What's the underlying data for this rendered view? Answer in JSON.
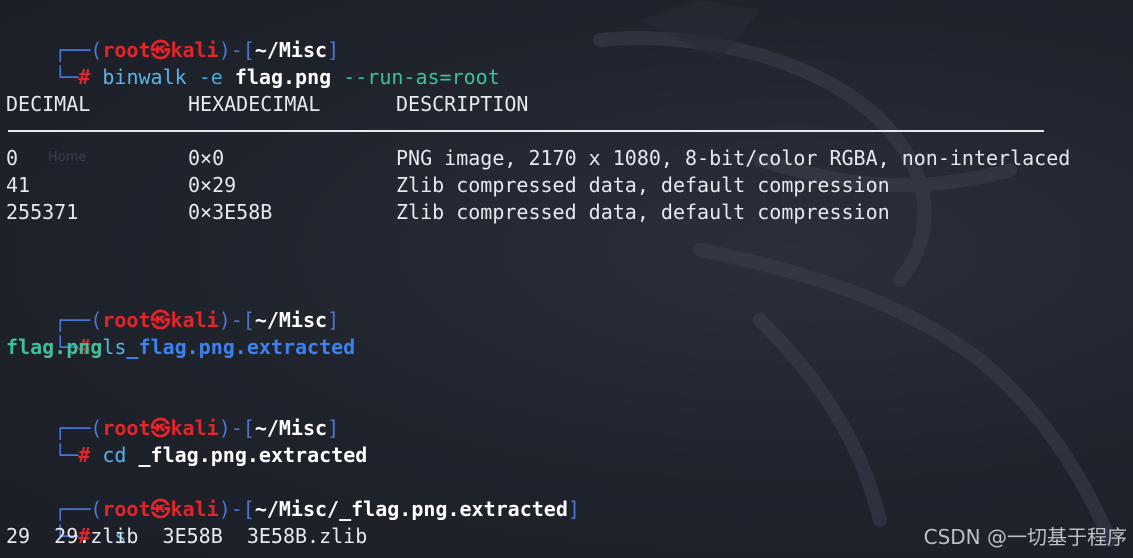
{
  "prompt": {
    "user": "root",
    "skull": "㉿",
    "host": "kali",
    "hash": "#"
  },
  "blocks": [
    {
      "path": "~/Misc",
      "command": "binwalk",
      "args": [
        {
          "text": "-e",
          "style": "opt-dim"
        },
        {
          "text": "flag.png",
          "style": "arg-bold"
        },
        {
          "text": "--run-as=root",
          "style": "opt"
        }
      ]
    },
    {
      "path": "~/Misc",
      "command": "ls",
      "args": []
    },
    {
      "path": "~/Misc",
      "command": "cd",
      "args": [
        {
          "text": "_flag.png.extracted",
          "style": "arg-bold"
        }
      ]
    },
    {
      "path": "~/Misc/_flag.png.extracted",
      "command": "ls",
      "args": []
    }
  ],
  "binwalk_table": {
    "headers": [
      "DECIMAL",
      "HEXADECIMAL",
      "DESCRIPTION"
    ],
    "rows": [
      [
        "0",
        "0×0",
        "PNG image, 2170 x 1080, 8-bit/color RGBA, non-interlaced"
      ],
      [
        "41",
        "0×29",
        "Zlib compressed data, default compression"
      ],
      [
        "255371",
        "0×3E58B",
        "Zlib compressed data, default compression"
      ]
    ]
  },
  "ls1_output": {
    "file": "flag.png",
    "dir": "_flag.png.extracted"
  },
  "ls2_output": "29  29.zlib  3E58B  3E58B.zlib",
  "watermark": "CSDN @一切基于程序",
  "ghost_labels": {
    "home": "Home"
  },
  "colors": {
    "background": "#1e222b",
    "prompt_red": "#e0262b",
    "bracket_blue": "#4b76d6",
    "command_cyan": "#59b3e8",
    "file_green": "#3fbf9a",
    "dir_blue": "#3b82f0"
  }
}
